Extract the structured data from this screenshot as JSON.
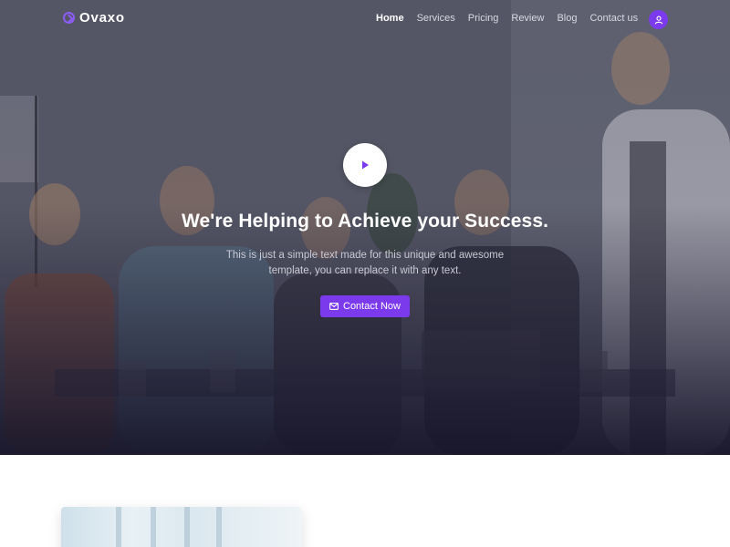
{
  "brand": {
    "name": "Ovaxo"
  },
  "nav": {
    "items": [
      {
        "label": "Home",
        "active": true
      },
      {
        "label": "Services",
        "active": false
      },
      {
        "label": "Pricing",
        "active": false
      },
      {
        "label": "Review",
        "active": false
      },
      {
        "label": "Blog",
        "active": false
      },
      {
        "label": "Contact us",
        "active": false
      }
    ]
  },
  "hero": {
    "title": "We're Helping to Achieve your Success.",
    "description": "This is just a simple text made for this unique and awesome template, you can replace it with any text.",
    "cta_label": "Contact Now"
  },
  "icons": {
    "brand": "brand-logo-icon",
    "user": "user-icon",
    "play": "play-icon",
    "cta": "envelope-icon"
  },
  "colors": {
    "accent": "#7c3aed",
    "nav_text": "#d9d9e3",
    "hero_text": "#ffffff"
  }
}
